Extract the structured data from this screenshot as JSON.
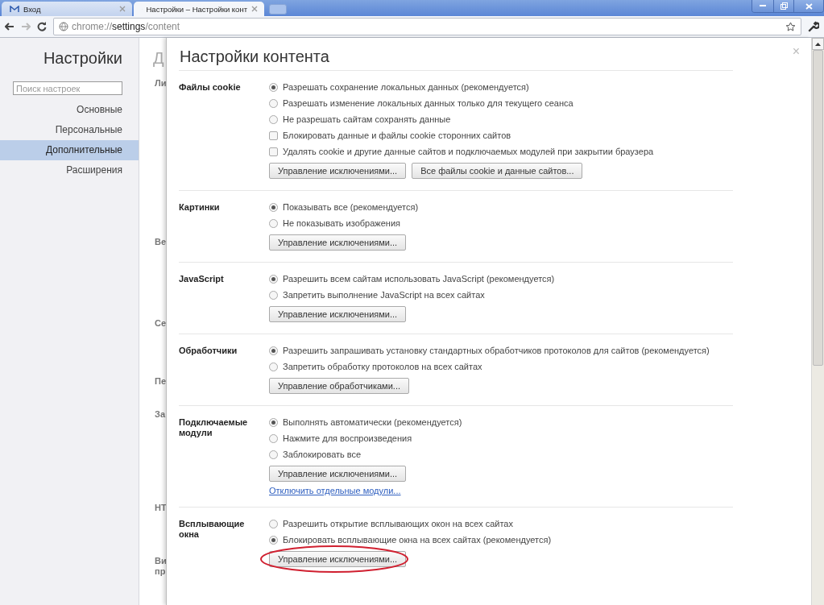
{
  "tabs": [
    {
      "title": "Вход",
      "selected": false
    },
    {
      "title": "Настройки – Настройки конт",
      "selected": true
    }
  ],
  "toolbar": {
    "url": {
      "scheme": "chrome://",
      "host": "settings",
      "path": "/content"
    }
  },
  "sidebar": {
    "title": "Настройки",
    "search": {
      "placeholder": "Поиск настроек"
    },
    "items": [
      {
        "label": "Основные",
        "selected": false
      },
      {
        "label": "Персональные",
        "selected": false
      },
      {
        "label": "Дополнительные",
        "selected": true
      },
      {
        "label": "Расширения",
        "selected": false
      }
    ]
  },
  "background_page": {
    "heading": "Д",
    "section_labels": [
      "Ли",
      "Ве",
      "Се",
      "Пе",
      "За",
      "НТ",
      "Ви пр"
    ]
  },
  "dialog": {
    "title": "Настройки контента",
    "close": "×",
    "sections": [
      {
        "label": "Файлы cookie",
        "options": [
          {
            "kind": "radio",
            "label": "Разрешать сохранение локальных данных (рекомендуется)",
            "selected": true
          },
          {
            "kind": "radio",
            "label": "Разрешать изменение локальных данных только для текущего сеанса",
            "selected": false
          },
          {
            "kind": "radio",
            "label": "Не разрешать сайтам сохранять данные",
            "selected": false
          },
          {
            "kind": "checkbox",
            "label": "Блокировать данные и файлы cookie сторонних сайтов",
            "checked": false
          },
          {
            "kind": "checkbox",
            "label": "Удалять cookie и другие данные сайтов и подключаемых модулей при закрытии браузера",
            "checked": false
          }
        ],
        "buttons": [
          {
            "label": "Управление исключениями...",
            "highlighted": false
          },
          {
            "label": "Все файлы cookie и данные сайтов...",
            "highlighted": false
          }
        ]
      },
      {
        "label": "Картинки",
        "options": [
          {
            "kind": "radio",
            "label": "Показывать все (рекомендуется)",
            "selected": true
          },
          {
            "kind": "radio",
            "label": "Не показывать изображения",
            "selected": false
          }
        ],
        "buttons": [
          {
            "label": "Управление исключениями...",
            "highlighted": false
          }
        ]
      },
      {
        "label": "JavaScript",
        "options": [
          {
            "kind": "radio",
            "label": "Разрешить всем сайтам использовать JavaScript (рекомендуется)",
            "selected": true
          },
          {
            "kind": "radio",
            "label": "Запретить выполнение JavaScript на всех сайтах",
            "selected": false
          }
        ],
        "buttons": [
          {
            "label": "Управление исключениями...",
            "highlighted": false
          }
        ]
      },
      {
        "label": "Обработчики",
        "options": [
          {
            "kind": "radio",
            "label": "Разрешить запрашивать установку стандартных обработчиков протоколов для сайтов (рекомендуется)",
            "selected": true
          },
          {
            "kind": "radio",
            "label": "Запретить обработку протоколов на всех сайтах",
            "selected": false
          }
        ],
        "buttons": [
          {
            "label": "Управление обработчиками...",
            "highlighted": false
          }
        ]
      },
      {
        "label": "Подключаемые модули",
        "options": [
          {
            "kind": "radio",
            "label": "Выполнять автоматически (рекомендуется)",
            "selected": true
          },
          {
            "kind": "radio",
            "label": "Нажмите для воспроизведения",
            "selected": false
          },
          {
            "kind": "radio",
            "label": "Заблокировать все",
            "selected": false
          }
        ],
        "buttons": [
          {
            "label": "Управление исключениями...",
            "highlighted": false
          }
        ],
        "link": "Отключить отдельные модули..."
      },
      {
        "label": "Всплывающие окна",
        "options": [
          {
            "kind": "radio",
            "label": "Разрешить открытие всплывающих окон на всех сайтах",
            "selected": false
          },
          {
            "kind": "radio",
            "label": "Блокировать всплывающие окна на всех сайтах (рекомендуется)",
            "selected": true
          }
        ],
        "buttons": [
          {
            "label": "Управление исключениями...",
            "highlighted": true
          }
        ]
      }
    ]
  }
}
